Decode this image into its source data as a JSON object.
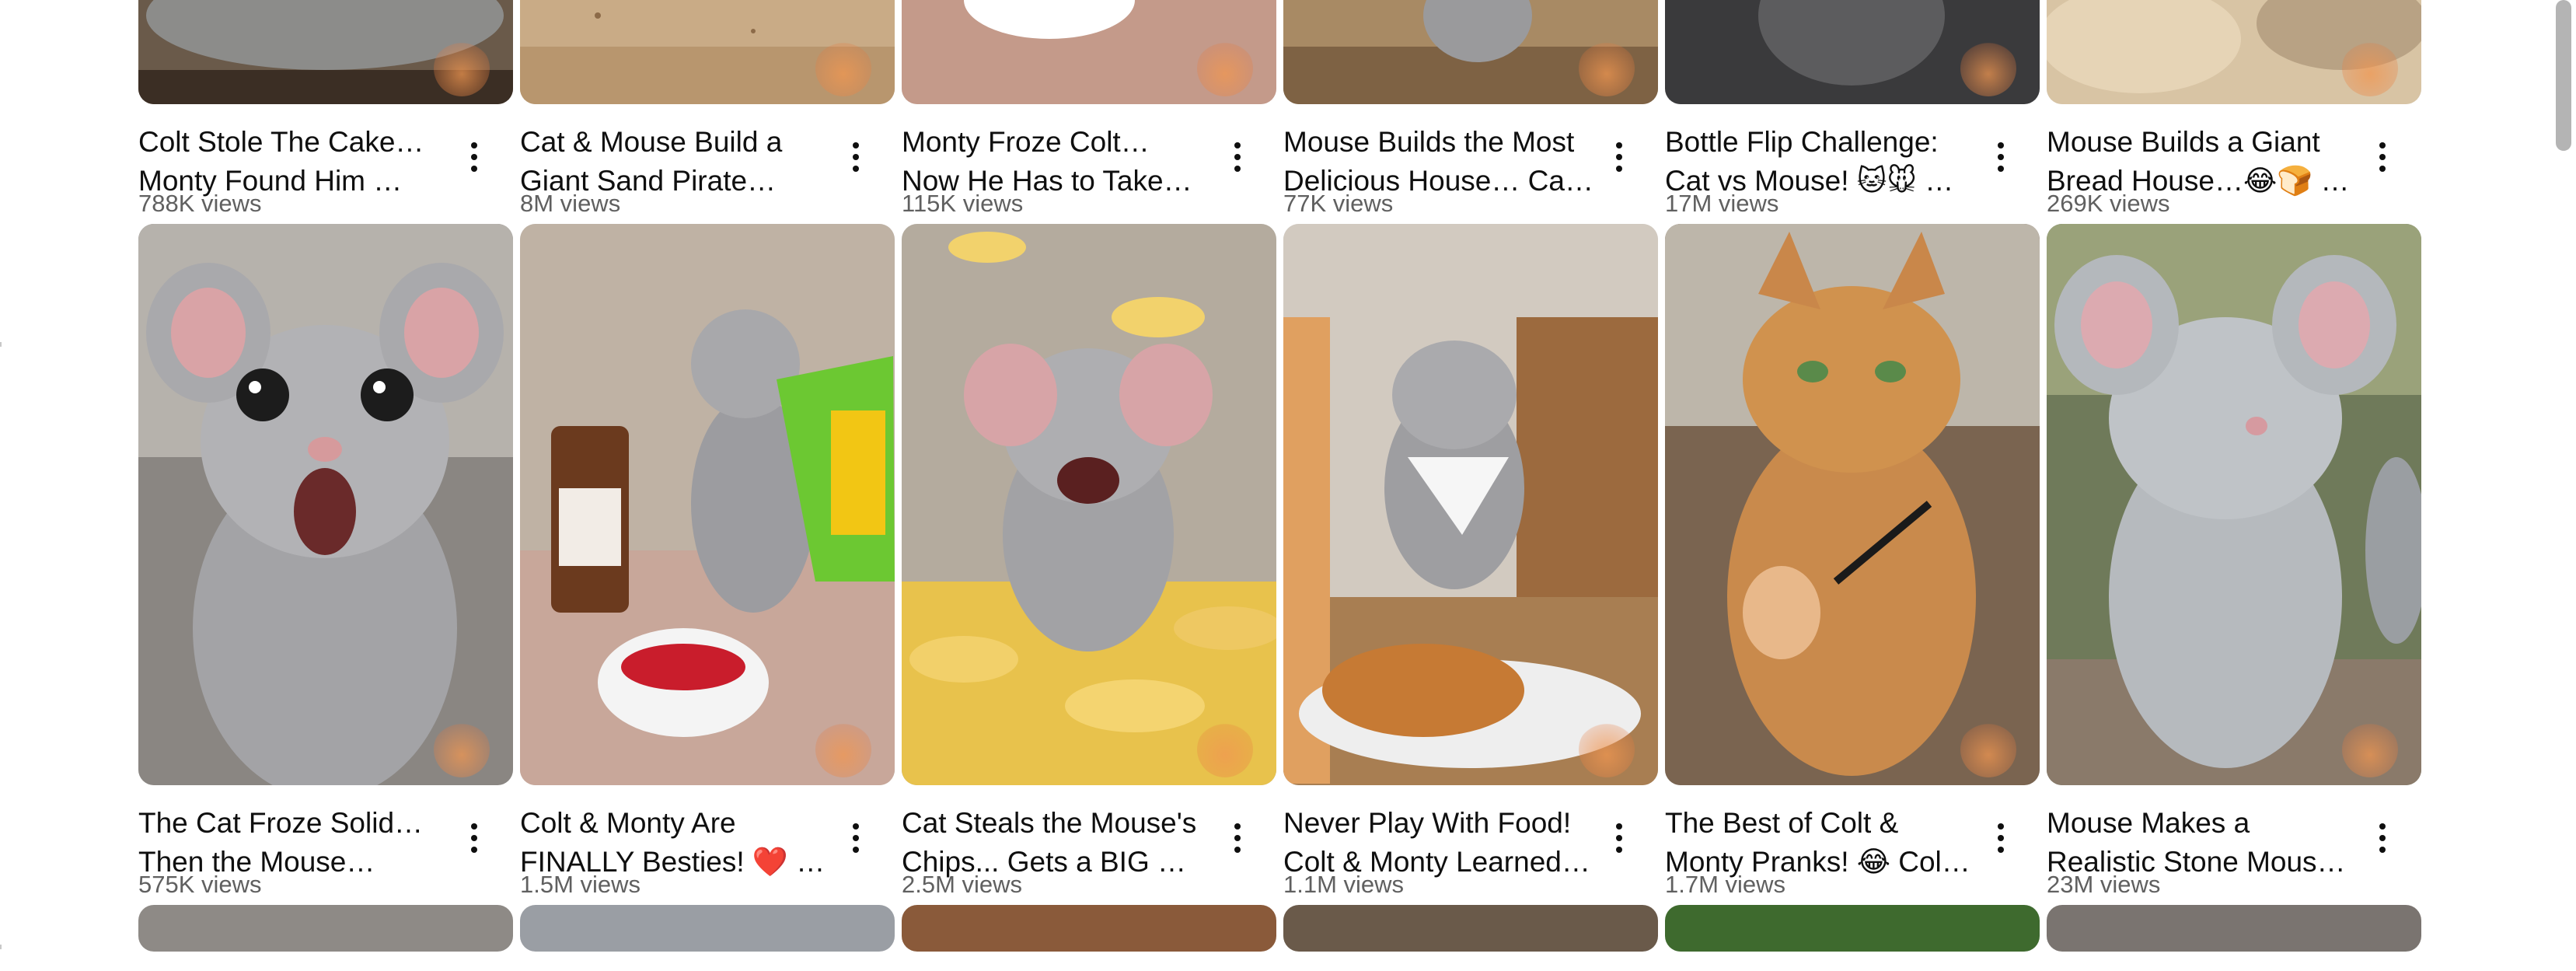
{
  "colors": {
    "title": "#0f0f0f",
    "views": "#606060",
    "background": "#ffffff",
    "scrollbar": "#b4b4b4"
  },
  "videos_row1": [
    {
      "title": "Colt Stole The Cake… Monty Found Him …",
      "views": "788K views"
    },
    {
      "title": "Cat & Mouse Build a Giant Sand Pirate Ship…",
      "views": "8M views"
    },
    {
      "title": "Monty Froze Colt… Now He Has to Take Care of…",
      "views": "115K views"
    },
    {
      "title": "Mouse Builds the Most Delicious House… Cat …",
      "views": "77K views"
    },
    {
      "title": "Bottle Flip Challenge: Cat vs Mouse! 🐱🐭 …",
      "views": "17M views"
    },
    {
      "title": "Mouse Builds a Giant Bread House…😂🍞 …",
      "views": "269K views"
    }
  ],
  "videos_row2": [
    {
      "title": "The Cat Froze Solid… Then the Mouse Saved…",
      "views": "575K views"
    },
    {
      "title": "Colt & Monty Are FINALLY Besties! ❤️ …",
      "views": "1.5M views"
    },
    {
      "title": "Cat Steals the Mouse's Chips... Gets a BIG …",
      "views": "2.5M views"
    },
    {
      "title": "Never Play With Food! Colt & Monty Learned …",
      "views": "1.1M views"
    },
    {
      "title": "The Best of Colt & Monty Pranks! 😂 Colt …",
      "views": "1.7M views"
    },
    {
      "title": "Mouse Makes a Realistic Stone Mouse …",
      "views": "23M views"
    }
  ],
  "icons": {
    "more": "kebab-menu-icon"
  }
}
